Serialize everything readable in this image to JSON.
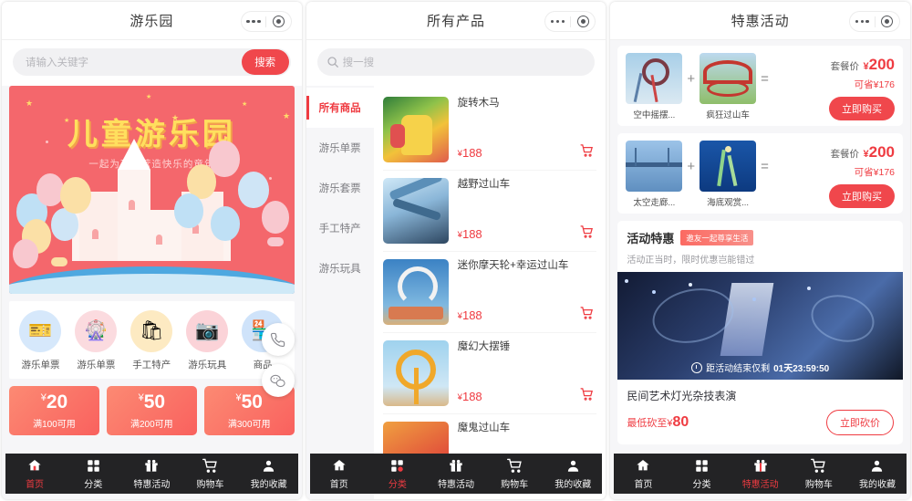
{
  "theme": {
    "accent": "#ef3b41",
    "accent_soft": "#f0474c",
    "tabbar_bg": "#232325",
    "page_bg": "#f6f6f8"
  },
  "panel1": {
    "header": {
      "title": "游乐园",
      "capsule_more": "more-dots",
      "capsule_target": "target-circle"
    },
    "search": {
      "placeholder": "请输入关键字",
      "button": "搜索"
    },
    "banner": {
      "title": "儿童游乐园",
      "subtitle": "一起为孩子营造快乐的童年"
    },
    "categories": [
      {
        "label": "游乐单票",
        "icon": "ticket-icon",
        "bg": "#d6e8fb",
        "glyph": "🎫"
      },
      {
        "label": "游乐单票",
        "icon": "ferris-wheel-icon",
        "bg": "#fbdbdf",
        "glyph": "🎡"
      },
      {
        "label": "手工特产",
        "icon": "gift-bag-icon",
        "bg": "#fdeac2",
        "glyph": "🛍"
      },
      {
        "label": "游乐玩具",
        "icon": "camera-icon",
        "bg": "#fbd3d8",
        "glyph": "📷"
      },
      {
        "label": "商品",
        "icon": "shop-icon",
        "bg": "#cfe3fa",
        "glyph": "🏪"
      }
    ],
    "coupons": [
      {
        "currency": "¥",
        "amount": "20",
        "condition": "满100可用"
      },
      {
        "currency": "¥",
        "amount": "50",
        "condition": "满200可用"
      },
      {
        "currency": "¥",
        "amount": "50",
        "condition": "满300可用"
      }
    ],
    "fabs": [
      {
        "name": "phone-icon"
      },
      {
        "name": "wechat-icon"
      }
    ],
    "tabs": [
      {
        "label": "首页",
        "icon": "home-icon",
        "active": true
      },
      {
        "label": "分类",
        "icon": "grid-icon",
        "active": false
      },
      {
        "label": "特惠活动",
        "icon": "gift-icon",
        "active": false
      },
      {
        "label": "购物车",
        "icon": "cart-icon",
        "active": false
      },
      {
        "label": "我的收藏",
        "icon": "user-icon",
        "active": false
      }
    ]
  },
  "panel2": {
    "header": {
      "title": "所有产品"
    },
    "search": {
      "placeholder": "搜一搜",
      "icon": "search-icon"
    },
    "categories": [
      {
        "label": "所有商品",
        "active": true
      },
      {
        "label": "游乐单票",
        "active": false
      },
      {
        "label": "游乐套票",
        "active": false
      },
      {
        "label": "手工特产",
        "active": false
      },
      {
        "label": "游乐玩具",
        "active": false
      }
    ],
    "products": [
      {
        "name": "旋转木马",
        "currency": "¥",
        "price": "188",
        "img": "carousel",
        "cart": "cart-icon"
      },
      {
        "name": "越野过山车",
        "currency": "¥",
        "price": "188",
        "img": "coaster-blue",
        "cart": "cart-icon"
      },
      {
        "name": "迷你摩天轮+幸运过山车",
        "currency": "¥",
        "price": "188",
        "img": "coaster-sky",
        "cart": "cart-icon"
      },
      {
        "name": "魔幻大摆锤",
        "currency": "¥",
        "price": "188",
        "img": "pendulum",
        "cart": "cart-icon"
      },
      {
        "name": "魔鬼过山车",
        "currency": "¥",
        "price": "",
        "img": "coaster-red",
        "cart": "cart-icon"
      }
    ],
    "tabs": [
      {
        "label": "首页",
        "icon": "home-icon",
        "active": false
      },
      {
        "label": "分类",
        "icon": "grid-icon",
        "active": true
      },
      {
        "label": "特惠活动",
        "icon": "gift-icon",
        "active": false
      },
      {
        "label": "购物车",
        "icon": "cart-icon",
        "active": false
      },
      {
        "label": "我的收藏",
        "icon": "user-icon",
        "active": false
      }
    ]
  },
  "panel3": {
    "header": {
      "title": "特惠活动"
    },
    "bundles": [
      {
        "left": {
          "label": "空中摇摆...",
          "img": "swing"
        },
        "right": {
          "label": "疯狂过山车",
          "img": "coaster-red"
        },
        "plus": "+",
        "equals": "=",
        "price_label": "套餐价",
        "currency": "¥",
        "price": "200",
        "save": "可省¥176",
        "button": "立即购买"
      },
      {
        "left": {
          "label": "太空走廊...",
          "img": "bridge"
        },
        "right": {
          "label": "海底观赏...",
          "img": "ocean"
        },
        "plus": "+",
        "equals": "=",
        "price_label": "套餐价",
        "currency": "¥",
        "price": "200",
        "save": "可省¥176",
        "button": "立即购买"
      }
    ],
    "activity": {
      "title": "活动特惠",
      "badge": "邀友一起尊享生活",
      "subtitle": "活动正当时，限时优惠岂能错过",
      "countdown_label": "距活动结束仅剩",
      "countdown_value": "01天23:59:50",
      "name": "民间艺术灯光杂技表演",
      "lowest_label": "最低砍至¥",
      "lowest_price": "80",
      "button": "立即砍价"
    },
    "tabs": [
      {
        "label": "首页",
        "icon": "home-icon",
        "active": false
      },
      {
        "label": "分类",
        "icon": "grid-icon",
        "active": false
      },
      {
        "label": "特惠活动",
        "icon": "gift-icon",
        "active": true
      },
      {
        "label": "购物车",
        "icon": "cart-icon",
        "active": false
      },
      {
        "label": "我的收藏",
        "icon": "user-icon",
        "active": false
      }
    ]
  }
}
